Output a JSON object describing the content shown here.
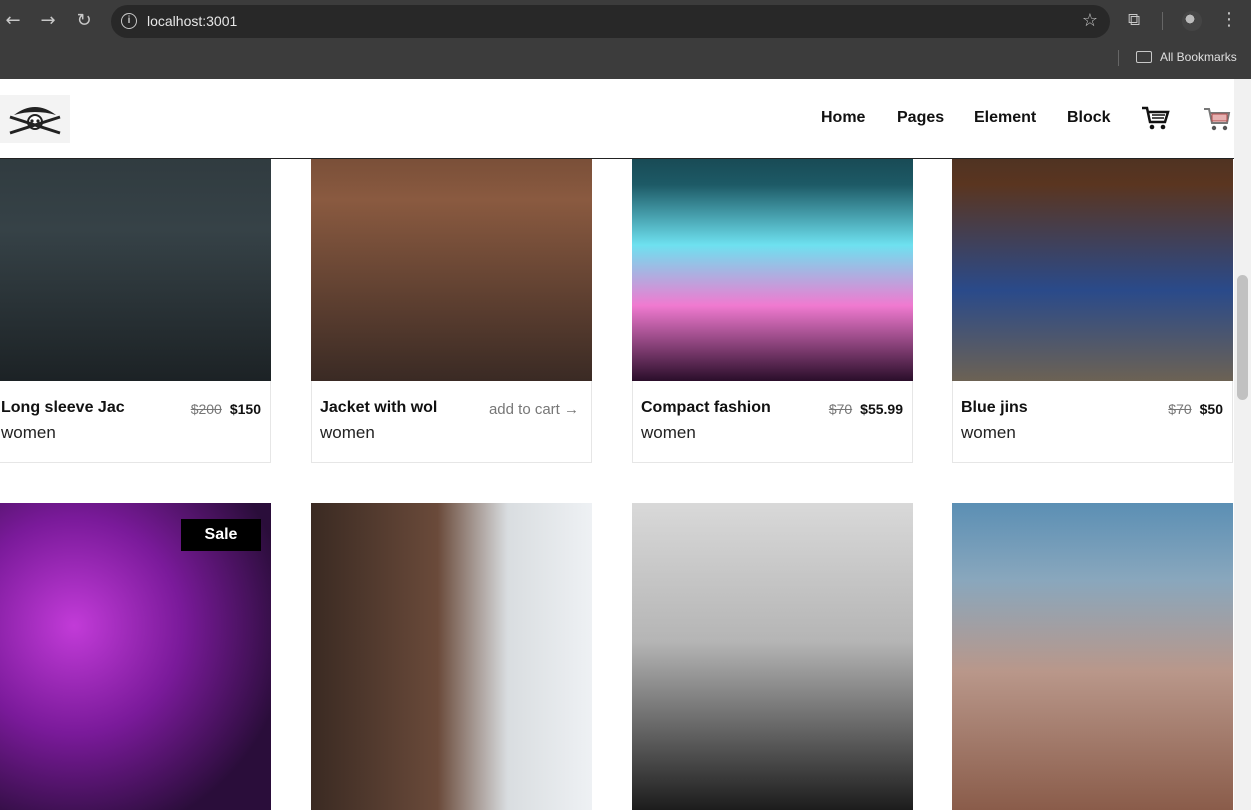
{
  "browser": {
    "url": "localhost:3001",
    "bookmarks_label": "All Bookmarks"
  },
  "header": {
    "nav": [
      "Home",
      "Pages",
      "Element",
      "Block"
    ]
  },
  "products": [
    {
      "title": "Long sleeve Jac",
      "category": "women",
      "old_price": "$200",
      "price": "$150"
    },
    {
      "title": "Jacket with wol",
      "category": "women",
      "action": "add to cart →"
    },
    {
      "title": "Compact fashion",
      "category": "women",
      "old_price": "$70",
      "price": "$55.99"
    },
    {
      "title": "Blue jins",
      "category": "women",
      "old_price": "$70",
      "price": "$50"
    }
  ],
  "second_row": {
    "sale_badge": "Sale"
  }
}
